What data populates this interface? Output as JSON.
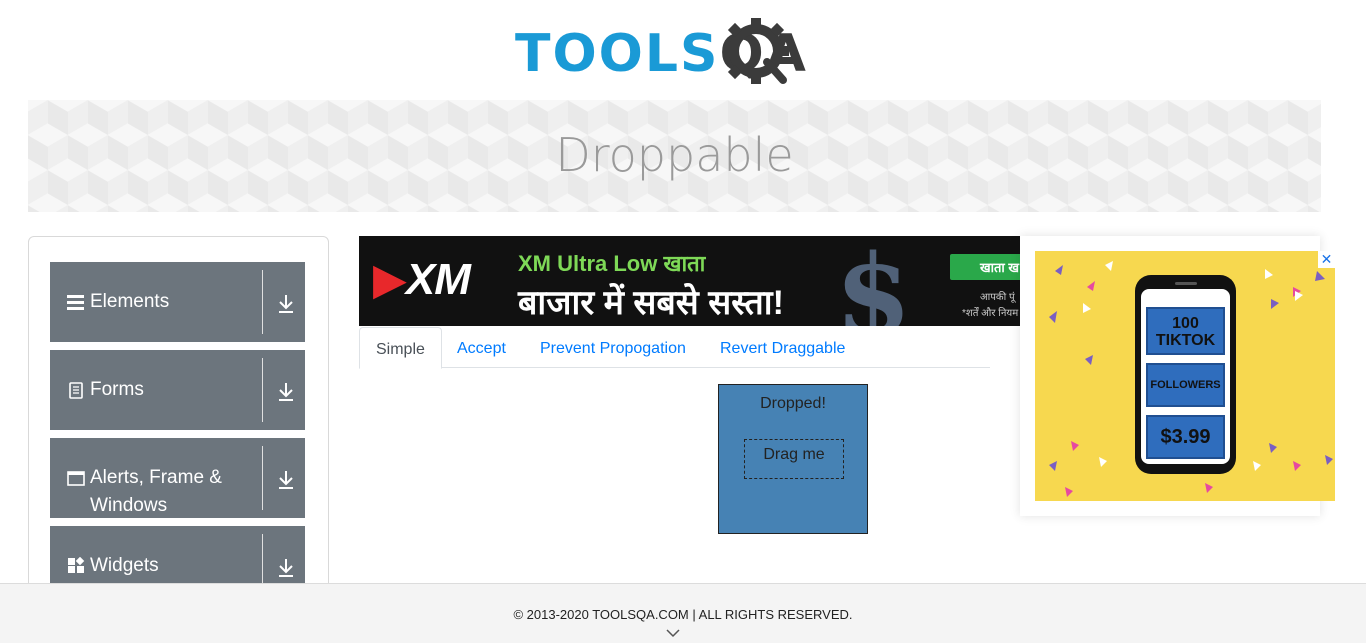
{
  "logo": {
    "text_a": "TOOLS",
    "text_b": "QA"
  },
  "banner": {
    "title": "Droppable"
  },
  "sidebar": {
    "groups": [
      {
        "label": "Elements",
        "icon": "hamburger-icon"
      },
      {
        "label": "Forms",
        "icon": "document-icon"
      },
      {
        "label": "Alerts, Frame & Windows",
        "icon": "window-icon"
      },
      {
        "label": "Widgets",
        "icon": "widgets-icon"
      }
    ]
  },
  "ad_top": {
    "brand": "XM",
    "line1": "XM Ultra Low खाता",
    "line2": "बाजार में सबसे सस्ता!",
    "cta": "खाता ख",
    "small1": "आपकी पूं",
    "small2": "*शर्तें और नियम"
  },
  "tabs": [
    {
      "label": "Simple",
      "active": true
    },
    {
      "label": "Accept",
      "active": false
    },
    {
      "label": "Prevent Propogation",
      "active": false
    },
    {
      "label": "Revert Draggable",
      "active": false
    }
  ],
  "droppable": {
    "text": "Dropped!",
    "color": "#4682b4"
  },
  "draggable": {
    "text": "Drag me"
  },
  "ad_right": {
    "line1": "100",
    "line2": "TIKTOK",
    "line3": "FOLLOWERS",
    "price": "$3.99",
    "close": "✕"
  },
  "footer": {
    "text": "© 2013-2020 TOOLSQA.COM | ALL RIGHTS RESERVED."
  },
  "colors": {
    "brand_blue": "#1a9ad6",
    "sidebar_gray": "#6c757d",
    "link": "#007bff"
  }
}
